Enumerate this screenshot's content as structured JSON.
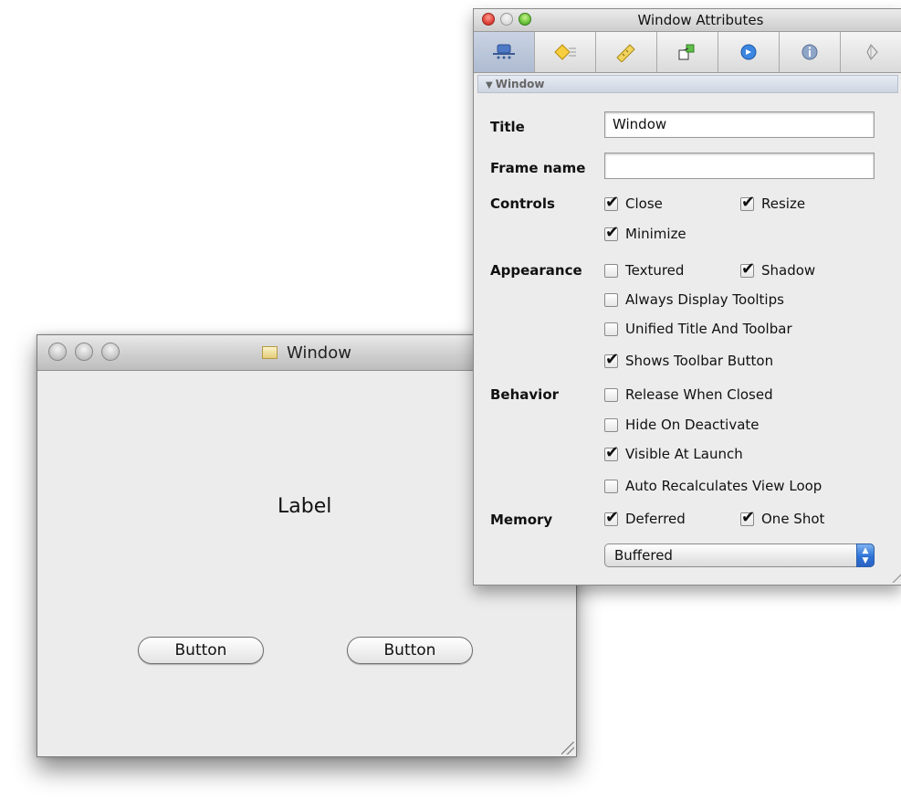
{
  "main_window": {
    "title": "Window",
    "label": "Label",
    "buttons": [
      "Button",
      "Button"
    ]
  },
  "inspector": {
    "title": "Window Attributes",
    "tabs": [
      {
        "icon": "attributes-icon",
        "selected": true
      },
      {
        "icon": "effects-icon",
        "selected": false
      },
      {
        "icon": "size-ruler-icon",
        "selected": false
      },
      {
        "icon": "connections-icon",
        "selected": false
      },
      {
        "icon": "bindings-icon",
        "selected": false
      },
      {
        "icon": "identity-icon",
        "selected": false
      },
      {
        "icon": "applescript-icon",
        "selected": false
      }
    ],
    "section": "Window",
    "fields": {
      "title_label": "Title",
      "title_value": "Window",
      "frame_name_label": "Frame name",
      "frame_name_value": ""
    },
    "controls": {
      "label": "Controls",
      "close": {
        "text": "Close",
        "checked": true
      },
      "resize": {
        "text": "Resize",
        "checked": true
      },
      "minimize": {
        "text": "Minimize",
        "checked": true
      }
    },
    "appearance": {
      "label": "Appearance",
      "textured": {
        "text": "Textured",
        "checked": false
      },
      "shadow": {
        "text": "Shadow",
        "checked": true
      },
      "tooltips": {
        "text": "Always Display Tooltips",
        "checked": false
      },
      "unified": {
        "text": "Unified Title And Toolbar",
        "checked": false
      },
      "toolbar_button": {
        "text": "Shows Toolbar Button",
        "checked": true
      }
    },
    "behavior": {
      "label": "Behavior",
      "release": {
        "text": "Release When Closed",
        "checked": false
      },
      "hide": {
        "text": "Hide On Deactivate",
        "checked": false
      },
      "visible": {
        "text": "Visible At Launch",
        "checked": true
      },
      "recalc": {
        "text": "Auto Recalculates View Loop",
        "checked": false
      }
    },
    "memory": {
      "label": "Memory",
      "deferred": {
        "text": "Deferred",
        "checked": true
      },
      "one_shot": {
        "text": "One Shot",
        "checked": true
      },
      "backing": "Buffered"
    }
  }
}
